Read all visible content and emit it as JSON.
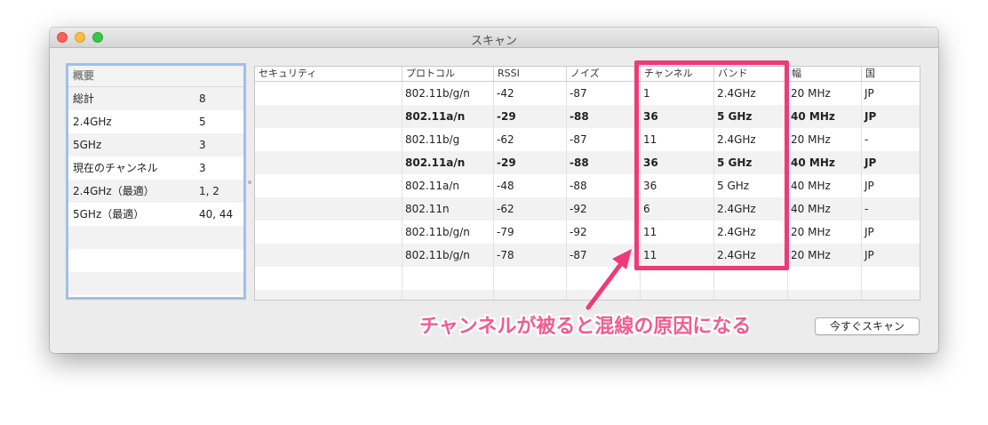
{
  "window": {
    "title": "スキャン"
  },
  "summary": {
    "header": "概要",
    "rows": [
      {
        "label": "総計",
        "value": "8"
      },
      {
        "label": "2.4GHz",
        "value": "5"
      },
      {
        "label": "5GHz",
        "value": "3"
      },
      {
        "label": "現在のチャンネル",
        "value": "3"
      },
      {
        "label": "2.4GHz（最適）",
        "value": "1, 2"
      },
      {
        "label": "5GHz（最適）",
        "value": "40, 44"
      }
    ]
  },
  "table": {
    "columns": [
      "セキュリティ",
      "プロトコル",
      "RSSI",
      "ノイズ",
      "チャンネル",
      "バンド",
      "幅",
      "国"
    ],
    "rows": [
      {
        "protocol": "802.11b/g/n",
        "rssi": "-42",
        "noise": "-87",
        "channel": "1",
        "band": "2.4GHz",
        "width": "20 MHz",
        "country": "JP",
        "bold": false
      },
      {
        "protocol": "802.11a/n",
        "rssi": "-29",
        "noise": "-88",
        "channel": "36",
        "band": "5 GHz",
        "width": "40 MHz",
        "country": "JP",
        "bold": true
      },
      {
        "protocol": "802.11b/g",
        "rssi": "-62",
        "noise": "-87",
        "channel": "11",
        "band": "2.4GHz",
        "width": "20 MHz",
        "country": "-",
        "bold": false
      },
      {
        "protocol": "802.11a/n",
        "rssi": "-29",
        "noise": "-88",
        "channel": "36",
        "band": "5 GHz",
        "width": "40 MHz",
        "country": "JP",
        "bold": true
      },
      {
        "protocol": "802.11a/n",
        "rssi": "-48",
        "noise": "-88",
        "channel": "36",
        "band": "5 GHz",
        "width": "40 MHz",
        "country": "JP",
        "bold": false
      },
      {
        "protocol": "802.11n",
        "rssi": "-62",
        "noise": "-92",
        "channel": "6",
        "band": "2.4GHz",
        "width": "40 MHz",
        "country": "-",
        "bold": false
      },
      {
        "protocol": "802.11b/g/n",
        "rssi": "-79",
        "noise": "-92",
        "channel": "11",
        "band": "2.4GHz",
        "width": "20 MHz",
        "country": "JP",
        "bold": false
      },
      {
        "protocol": "802.11b/g/n",
        "rssi": "-78",
        "noise": "-87",
        "channel": "11",
        "band": "2.4GHz",
        "width": "20 MHz",
        "country": "JP",
        "bold": false
      }
    ]
  },
  "annotation": {
    "text": "チャンネルが被ると混線の原因になる",
    "color": "#ee3a78"
  },
  "scan_button": {
    "label": "今すぐスキャン"
  }
}
